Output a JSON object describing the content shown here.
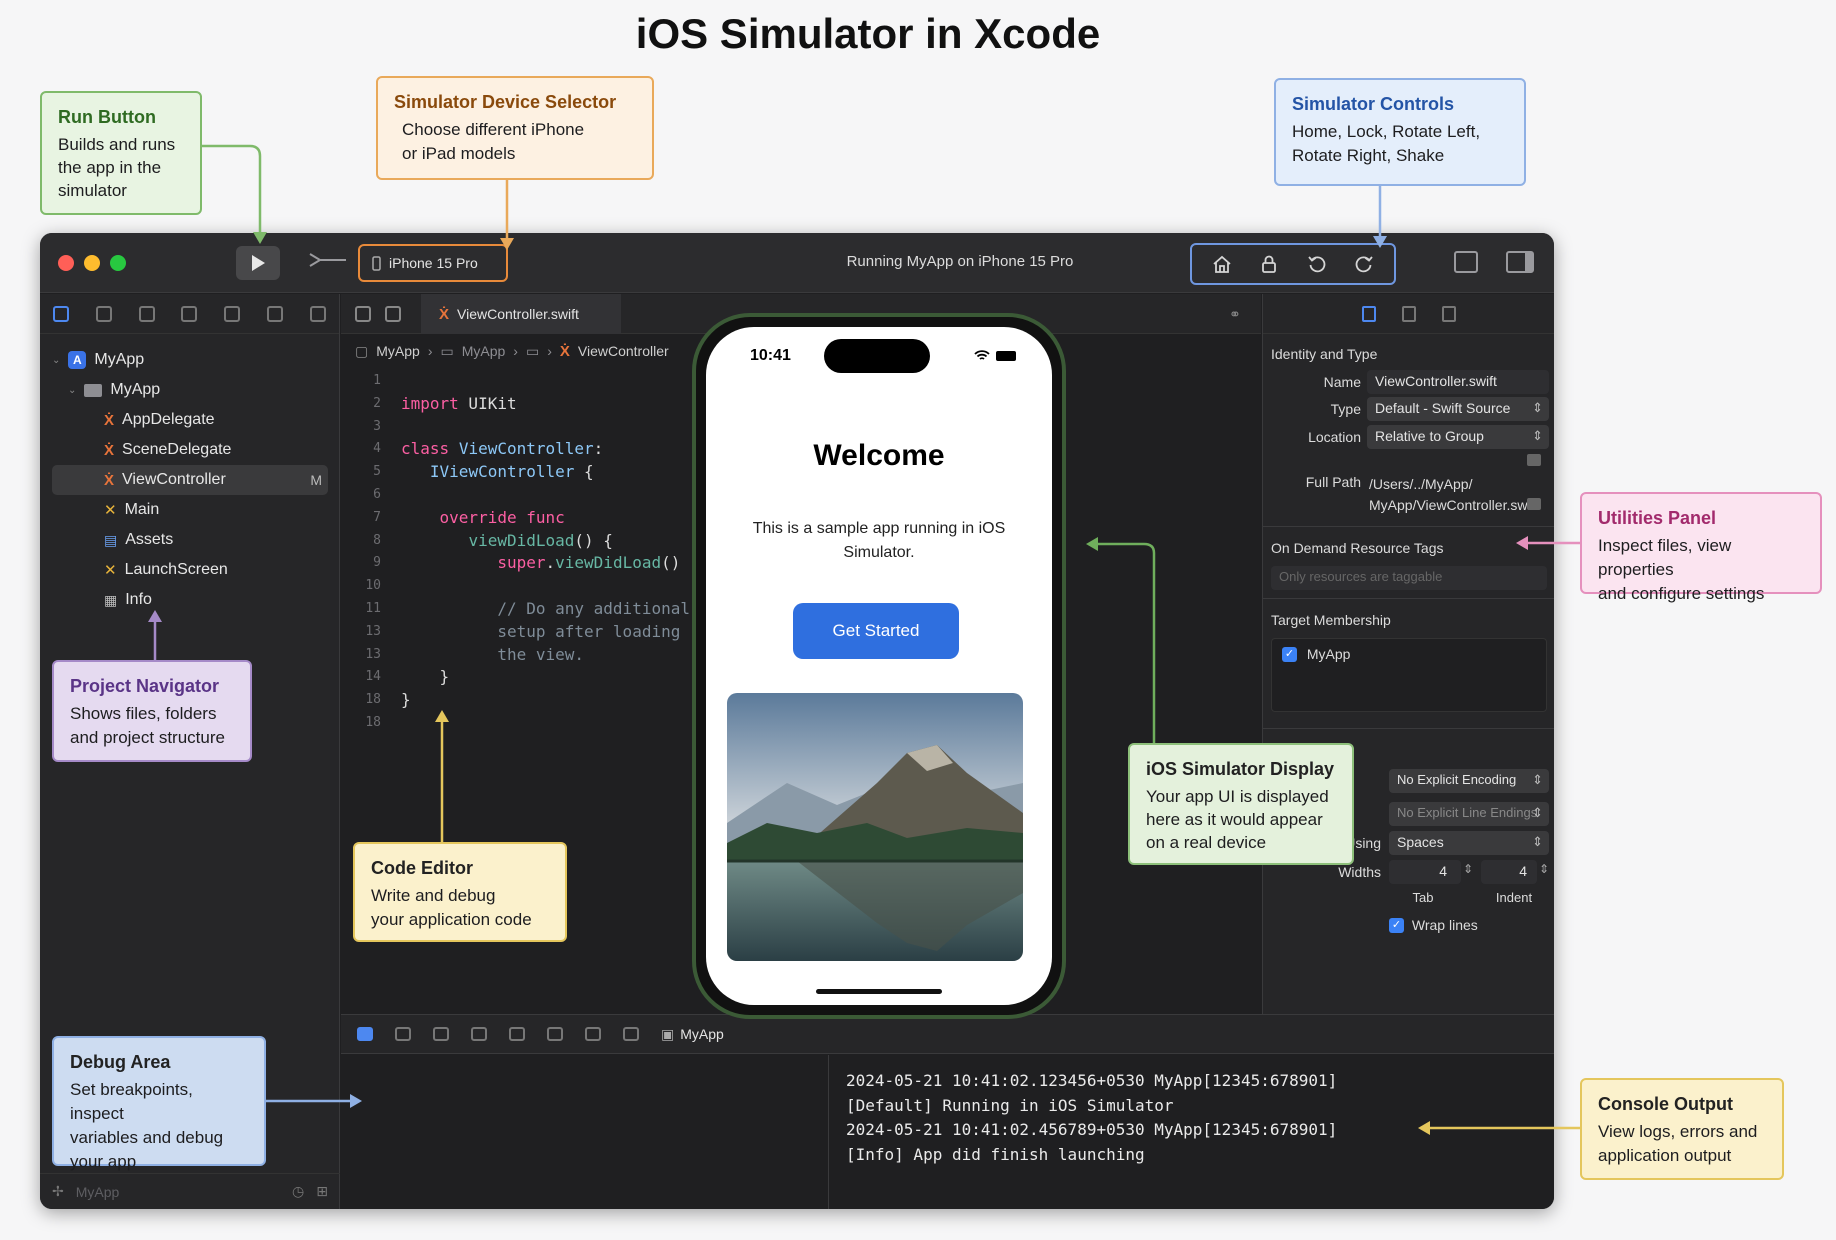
{
  "page_title": "iOS Simulator in Xcode",
  "callouts": {
    "run": {
      "title": "Run Button",
      "body": "Builds and runs\nthe app in the\nsimulator"
    },
    "device": {
      "title": "Simulator Device Selector",
      "body": "Choose different iPhone\nor iPad models"
    },
    "controls": {
      "title": "Simulator Controls",
      "body": "Home, Lock, Rotate Left,\nRotate Right, Shake"
    },
    "utilities": {
      "title": "Utilities Panel",
      "body": "Inspect files, view properties\nand configure settings"
    },
    "navigator": {
      "title": "Project Navigator",
      "body": "Shows files, folders\nand project structure"
    },
    "editor": {
      "title": "Code Editor",
      "body": "Write and debug\nyour application code"
    },
    "display": {
      "title": "iOS Simulator Display",
      "body": "Your app UI is displayed\nhere as it would appear\non a real device"
    },
    "debug": {
      "title": "Debug Area",
      "body": "Set breakpoints, inspect\nvariables and debug\nyour app"
    },
    "console": {
      "title": "Console Output",
      "body": "View logs, errors and\napplication output"
    }
  },
  "toolbar": {
    "device": "iPhone 15 Pro",
    "status": "Running MyApp on iPhone 15 Pro",
    "controls": [
      "house-icon",
      "lock-icon",
      "rotate-left-icon",
      "rotate-right-icon"
    ]
  },
  "navigator": {
    "items": [
      {
        "label": "MyApp",
        "icon": "app-icon"
      },
      {
        "label": "MyApp",
        "icon": "folder-icon"
      },
      {
        "label": "AppDelegate",
        "icon": "swift-icon"
      },
      {
        "label": "SceneDelegate",
        "icon": "swift-icon"
      },
      {
        "label": "ViewController",
        "icon": "swift-icon",
        "badge": "M"
      },
      {
        "label": "Main",
        "icon": "storyboard-icon"
      },
      {
        "label": "Assets",
        "icon": "assets-icon"
      },
      {
        "label": "LaunchScreen",
        "icon": "storyboard-icon"
      },
      {
        "label": "Info",
        "icon": "table-icon"
      }
    ],
    "filter_placeholder": "MyApp"
  },
  "editor": {
    "tab": "ViewController.swift",
    "breadcrumb": [
      "MyApp",
      "MyApp",
      "ViewController"
    ],
    "line_numbers": [
      "1",
      "2",
      "3",
      "4",
      "5",
      "6",
      "7",
      "8",
      "9",
      "10",
      "11",
      "13",
      "13",
      "14",
      "18",
      "18"
    ]
  },
  "simulator": {
    "time": "10:41",
    "welcome": "Welcome",
    "subtitle": "This is a sample app running in iOS Simulator.",
    "button": "Get Started"
  },
  "inspector": {
    "identity_header": "Identity and Type",
    "name_label": "Name",
    "name_value": "ViewController.swift",
    "type_label": "Type",
    "type_value": "Default - Swift Source",
    "location_label": "Location",
    "location_value": "Relative to Group",
    "fullpath_label": "Full Path",
    "fullpath_value": "/Users/../MyApp/\nMyApp/ViewController.swift",
    "odr_header": "On Demand Resource Tags",
    "odr_placeholder": "Only resources are taggable",
    "target_header": "Target Membership",
    "target_item": "MyApp",
    "encoding_value": "No Explicit Encoding",
    "line_endings_value": "No Explicit Line Endings",
    "indent_label": "Indent Using",
    "indent_value": "Spaces",
    "widths_label": "Widths",
    "tab_width": "4",
    "indent_width": "4",
    "tab_label": "Tab",
    "indent_col_label": "Indent",
    "wrap_label": "Wrap lines"
  },
  "debug_bar": {
    "target": "MyApp"
  },
  "console": {
    "lines": [
      "2024-05-21 10:41:02.123456+0530 MyApp[12345:678901]",
      "[Default] Running in iOS Simulator",
      "2024-05-21 10:41:02.456789+0530 MyApp[12345:678901]",
      "[Info] App did finish launching"
    ]
  },
  "colors": {
    "accent": "#3b82f6",
    "run_callout": "#7fba6a",
    "device_callout": "#e9a95a",
    "controls_callout": "#8fb0e4"
  }
}
